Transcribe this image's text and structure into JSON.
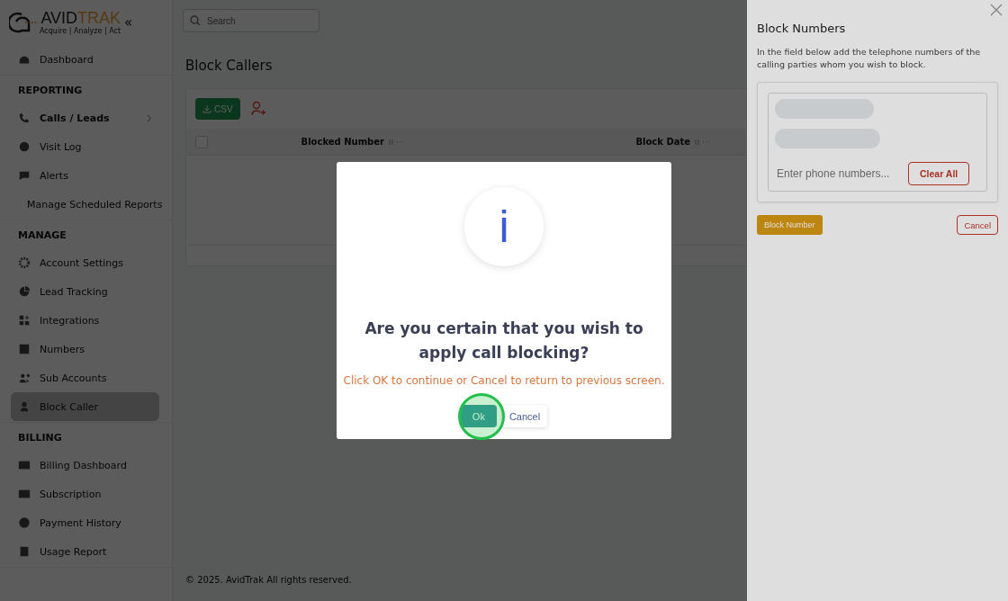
{
  "sidebar": {
    "logo": {
      "name_left": "AVID",
      "name_right": "TRAK",
      "tagline": "Acquire | Analyze | Act"
    },
    "collapse": "«",
    "sections": [
      {
        "items": [
          {
            "label": "Dashboard",
            "submenu": false,
            "selected": false
          }
        ]
      },
      {
        "title": "REPORTING",
        "items": [
          {
            "label": "Calls / Leads",
            "submenu": true,
            "selected": false
          },
          {
            "label": "Visit Log",
            "submenu": false,
            "selected": false
          },
          {
            "label": "Alerts",
            "submenu": false,
            "selected": false
          },
          {
            "label": "Manage Scheduled Reports",
            "submenu": false,
            "selected": false
          }
        ]
      },
      {
        "title": "MANAGE",
        "items": [
          {
            "label": "Account Settings",
            "submenu": false,
            "selected": false
          },
          {
            "label": "Lead Tracking",
            "submenu": false,
            "selected": false
          },
          {
            "label": "Integrations",
            "submenu": false,
            "selected": false
          },
          {
            "label": "Numbers",
            "submenu": false,
            "selected": false
          },
          {
            "label": "Sub Accounts",
            "submenu": false,
            "selected": false
          },
          {
            "label": "Block Caller",
            "submenu": false,
            "selected": true
          }
        ]
      },
      {
        "title": "BILLING",
        "items": [
          {
            "label": "Billing Dashboard",
            "submenu": false,
            "selected": false
          },
          {
            "label": "Subscription",
            "submenu": false,
            "selected": false
          },
          {
            "label": "Payment History",
            "submenu": false,
            "selected": false
          },
          {
            "label": "Usage Report",
            "submenu": false,
            "selected": false
          }
        ]
      }
    ]
  },
  "search": {
    "placeholder": "Search"
  },
  "page_title": "Block Callers",
  "toolbar": {
    "csv_button": "CSV"
  },
  "table": {
    "select_all_checked": false,
    "columns": [
      {
        "label": "Blocked Number"
      },
      {
        "label": "Block Date"
      }
    ]
  },
  "footer": "© 2025. AvidTrak All rights reserved.",
  "drawer": {
    "title": "Block Numbers",
    "description": "In the field below add the telephone numbers of the calling parties whom you wish to block.",
    "chips": [
      {
        "kind": "redacted"
      },
      {
        "kind": "redacted"
      }
    ],
    "input_placeholder": "Enter phone numbers...",
    "clear_button": "Clear All",
    "submit_button": "Block Number",
    "cancel_button": "Cancel"
  },
  "modal": {
    "icon_text": "i",
    "title": "Are you certain that you wish to apply call blocking?",
    "message": "Click OK to continue or Cancel to return to previous screen.",
    "ok_button": "Ok",
    "cancel_button": "Cancel",
    "click_highlight": true
  }
}
